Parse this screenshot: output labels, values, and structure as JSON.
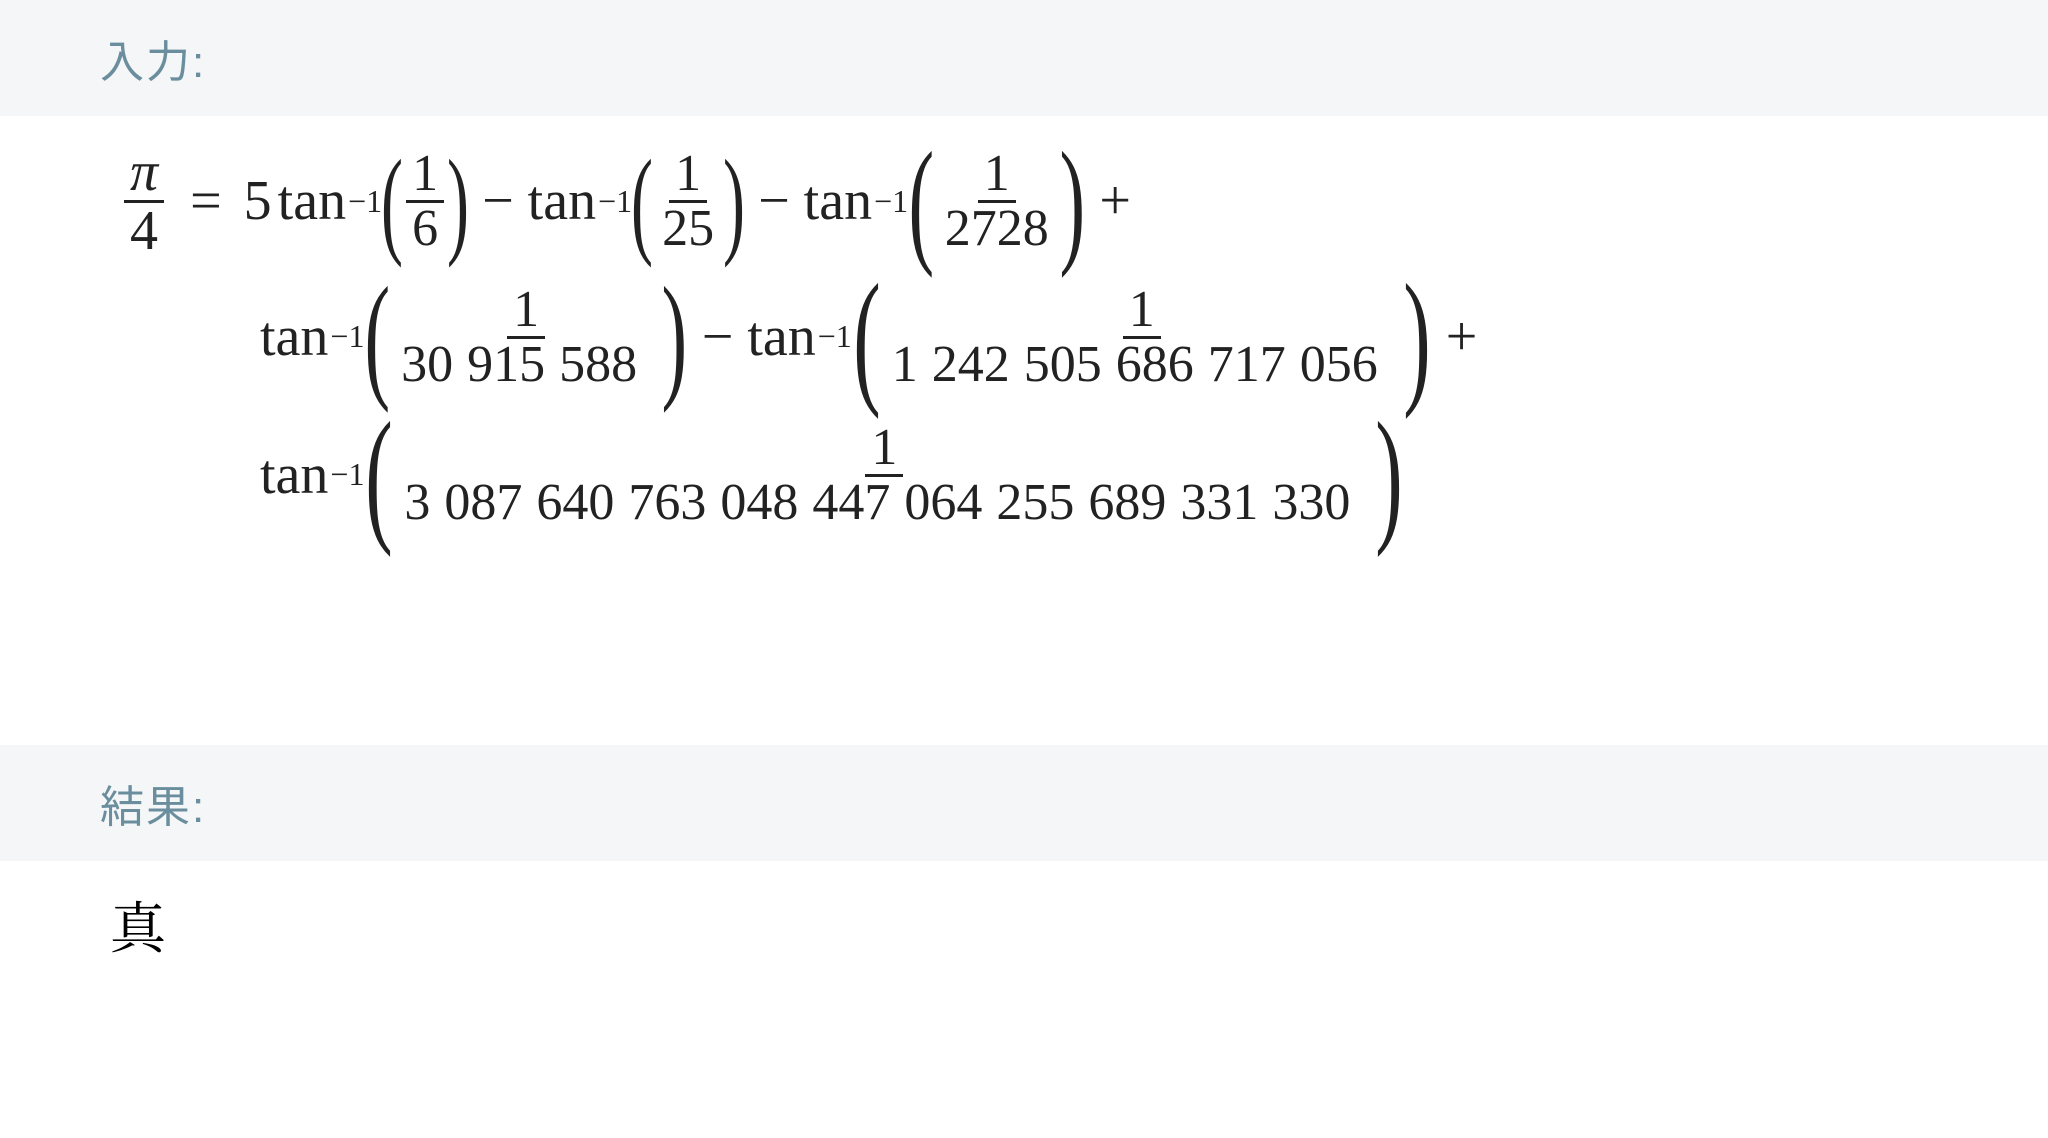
{
  "sections": {
    "input_label": "入力:",
    "result_label": "結果:"
  },
  "equation": {
    "lhs": {
      "num": "π",
      "den": "4"
    },
    "eq_sign": "=",
    "terms": [
      {
        "coef": "5",
        "fn": "tan",
        "exp": "−1",
        "arg": {
          "num": "1",
          "den": "6"
        },
        "trailing_op": "−"
      },
      {
        "coef": "",
        "fn": "tan",
        "exp": "−1",
        "arg": {
          "num": "1",
          "den": "25"
        },
        "trailing_op": "−"
      },
      {
        "coef": "",
        "fn": "tan",
        "exp": "−1",
        "arg": {
          "num": "1",
          "den": "2728"
        },
        "trailing_op": "+"
      },
      {
        "coef": "",
        "fn": "tan",
        "exp": "−1",
        "arg": {
          "num": "1",
          "den_groups": [
            "30",
            "915",
            "588"
          ]
        },
        "trailing_op": "−"
      },
      {
        "coef": "",
        "fn": "tan",
        "exp": "−1",
        "arg": {
          "num": "1",
          "den_groups": [
            "1",
            "242",
            "505",
            "686",
            "717",
            "056"
          ]
        },
        "trailing_op": "+"
      },
      {
        "coef": "",
        "fn": "tan",
        "exp": "−1",
        "arg": {
          "num": "1",
          "den_groups": [
            "3",
            "087",
            "640",
            "763",
            "048",
            "447",
            "064",
            "255",
            "689",
            "331",
            "330"
          ]
        },
        "trailing_op": ""
      }
    ]
  },
  "result": {
    "value": "真"
  }
}
